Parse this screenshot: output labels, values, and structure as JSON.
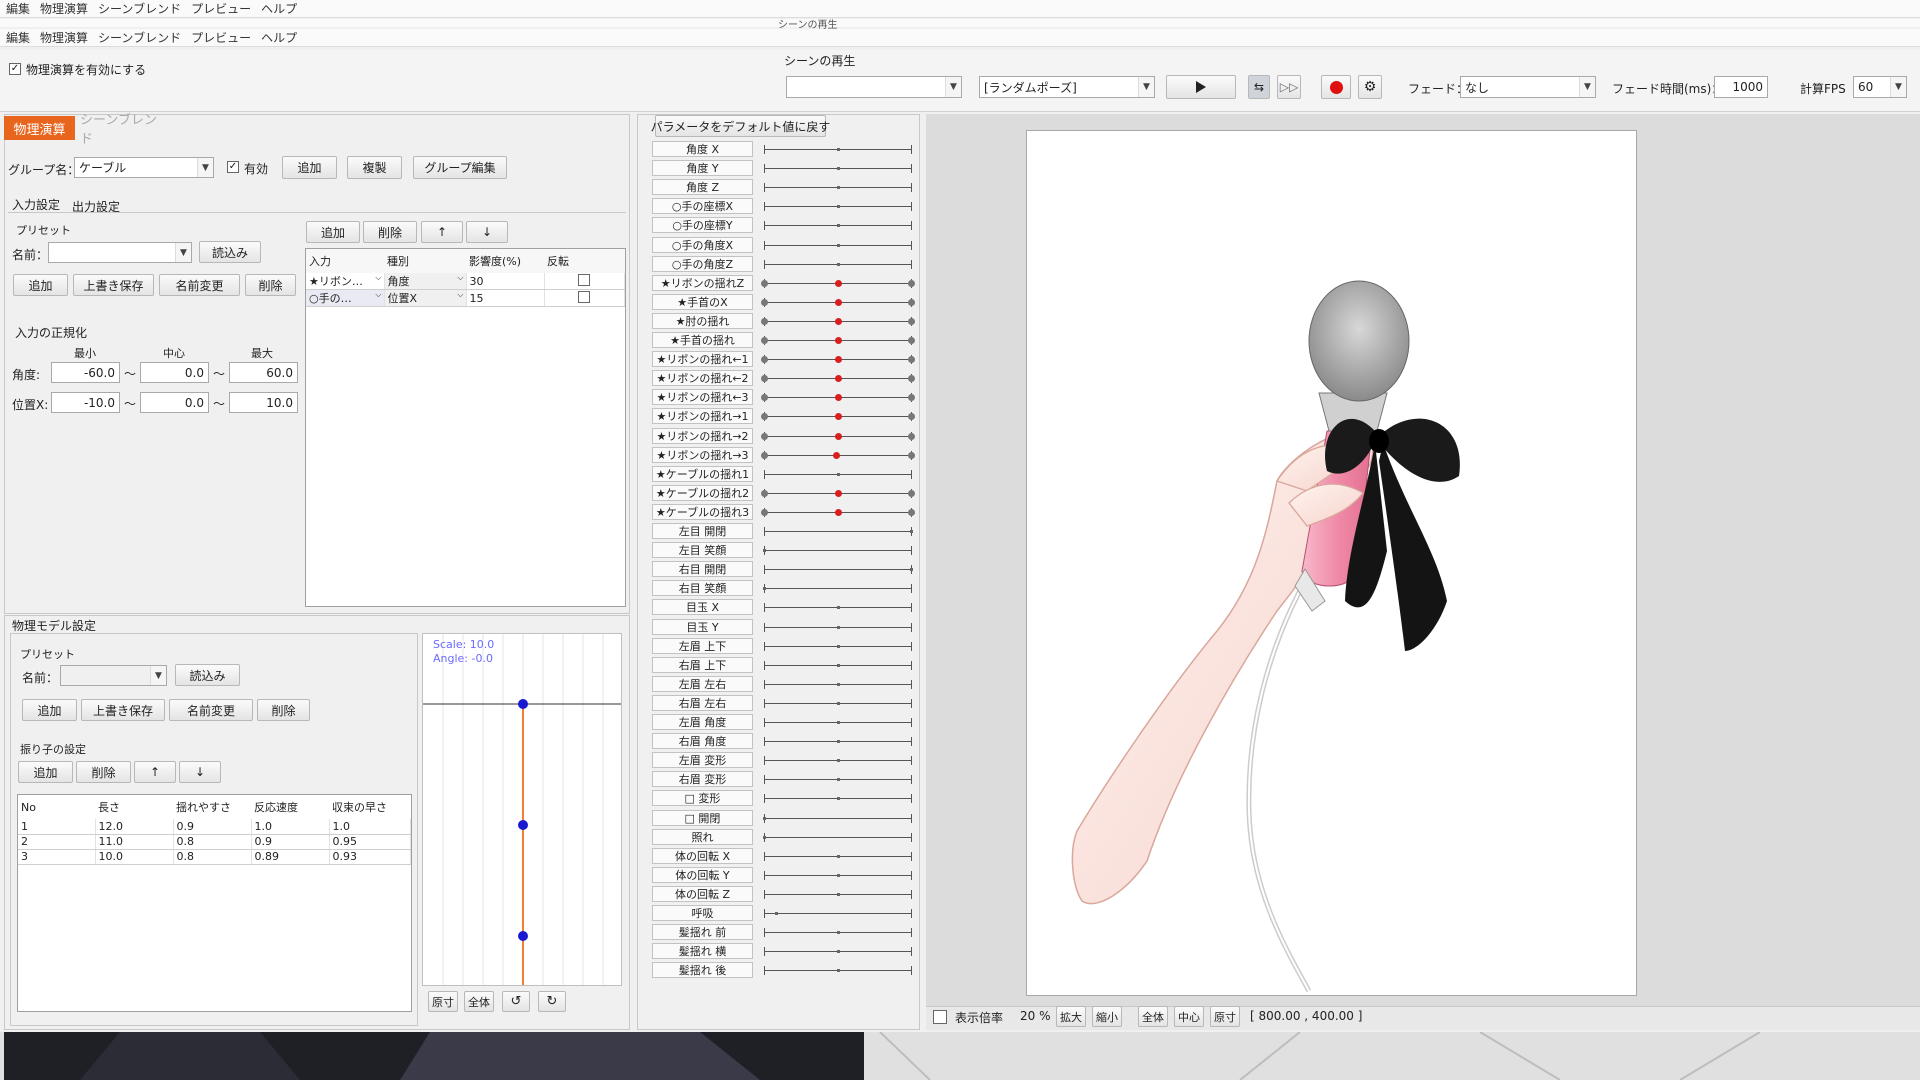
{
  "menu_top": [
    "編集",
    "物理演算",
    "シーンブレンド",
    "プレビュー",
    "ヘルプ"
  ],
  "menu_second": [
    "編集",
    "物理演算",
    "シーンブレンド",
    "プレビュー",
    "ヘルプ"
  ],
  "header_caption": "シーンの再生",
  "scene_play_label": "シーンの再生",
  "physics_enable_label": "物理演算を有効にする",
  "physics_enabled": true,
  "scene_select_value": "",
  "pose_select_value": "[ランダムポーズ]",
  "fade_label": "フェード：",
  "fade_value": "なし",
  "fade_time_label": "フェード時間(ms)：",
  "fade_time_value": "1000",
  "fps_label": "計算FPS",
  "fps_value": "60",
  "tabs": [
    "物理演算",
    "シーンブレンド"
  ],
  "group_label": "グループ名：",
  "group_value": "ケーブル",
  "enabled_label": "有効",
  "enabled_checked": true,
  "group_buttons": [
    "追加",
    "複製",
    "グループ編集"
  ],
  "sub_tabs": [
    "入力設定",
    "出力設定"
  ],
  "preset": {
    "title": "プリセット",
    "name_label": "名前：",
    "load_label": "読込み",
    "buttons": [
      "追加",
      "上書き保存",
      "名前変更",
      "削除"
    ]
  },
  "input_table_buttons": [
    "追加",
    "削除",
    "↑",
    "↓"
  ],
  "input_table": {
    "headers": [
      "入力",
      "種別",
      "影響度(%)",
      "反転"
    ],
    "rows": [
      {
        "input": "★リボン…",
        "type": "角度",
        "weight": "30",
        "invert": false
      },
      {
        "input": "○手の…",
        "type": "位置X",
        "weight": "15",
        "invert": false
      }
    ]
  },
  "normalize": {
    "title": "入力の正規化",
    "col_labels": [
      "最小",
      "中心",
      "最大"
    ],
    "rows": [
      {
        "label": "角度:",
        "min": "-60.0",
        "center": "0.0",
        "max": "60.0"
      },
      {
        "label": "位置X:",
        "min": "-10.0",
        "center": "0.0",
        "max": "10.0"
      }
    ],
    "separator": "～"
  },
  "model": {
    "title": "物理モデル設定",
    "preset_title": "プリセット",
    "name_label": "名前：",
    "load_label": "読込み",
    "buttons": [
      "追加",
      "上書き保存",
      "名前変更",
      "削除"
    ],
    "pendulum_title": "振り子の設定",
    "pendulum_buttons": [
      "追加",
      "削除",
      "↑",
      "↓"
    ],
    "table_headers": [
      "No",
      "長さ",
      "揺れやすさ",
      "反応速度",
      "収束の早さ"
    ],
    "table_rows": [
      [
        "1",
        "12.0",
        "0.9",
        "1.0",
        "1.0"
      ],
      [
        "2",
        "11.0",
        "0.8",
        "0.9",
        "0.95"
      ],
      [
        "3",
        "10.0",
        "0.8",
        "0.89",
        "0.93"
      ]
    ]
  },
  "pendulum_view": {
    "scale_text": "Scale: 10.0",
    "angle_text": "Angle: -0.0",
    "buttons": [
      "原寸",
      "全体",
      "↺",
      "↻"
    ]
  },
  "reset_params_label": "パラメータをデフォルト値に戻す",
  "parameters": [
    {
      "label": "角度 X",
      "dot": 0.5,
      "style": "plain"
    },
    {
      "label": "角度 Y",
      "dot": 0.5,
      "style": "plain"
    },
    {
      "label": "角度 Z",
      "dot": 0.5,
      "style": "plain"
    },
    {
      "label": "○手の座標X",
      "dot": 0.5,
      "style": "plain"
    },
    {
      "label": "○手の座標Y",
      "dot": 0.5,
      "style": "plain"
    },
    {
      "label": "○手の角度X",
      "dot": 0.5,
      "style": "plain"
    },
    {
      "label": "○手の角度Z",
      "dot": 0.5,
      "style": "plain"
    },
    {
      "label": "★リボンの揺れZ",
      "dot": 0.5,
      "style": "red"
    },
    {
      "label": "★手首のX",
      "dot": 0.5,
      "style": "red"
    },
    {
      "label": "★肘の揺れ",
      "dot": 0.5,
      "style": "red"
    },
    {
      "label": "★手首の揺れ",
      "dot": 0.5,
      "style": "red"
    },
    {
      "label": "★リボンの揺れ←1",
      "dot": 0.5,
      "style": "red"
    },
    {
      "label": "★リボンの揺れ←2",
      "dot": 0.5,
      "style": "red"
    },
    {
      "label": "★リボンの揺れ←3",
      "dot": 0.5,
      "style": "red"
    },
    {
      "label": "★リボンの揺れ→1",
      "dot": 0.5,
      "style": "red"
    },
    {
      "label": "★リボンの揺れ→2",
      "dot": 0.5,
      "style": "red"
    },
    {
      "label": "★リボンの揺れ→3",
      "dot": 0.49,
      "style": "red"
    },
    {
      "label": "★ケーブルの揺れ1",
      "dot": 0.5,
      "style": "plain"
    },
    {
      "label": "★ケーブルの揺れ2",
      "dot": 0.5,
      "style": "red"
    },
    {
      "label": "★ケーブルの揺れ3",
      "dot": 0.5,
      "style": "red"
    },
    {
      "label": "左目 開閉",
      "dot": 1.0,
      "style": "end"
    },
    {
      "label": "左目 笑顔",
      "dot": 0.0,
      "style": "end"
    },
    {
      "label": "右目 開閉",
      "dot": 1.0,
      "style": "end"
    },
    {
      "label": "右目 笑顔",
      "dot": 0.0,
      "style": "end"
    },
    {
      "label": "目玉 X",
      "dot": 0.5,
      "style": "plain"
    },
    {
      "label": "目玉 Y",
      "dot": 0.5,
      "style": "plain"
    },
    {
      "label": "左眉 上下",
      "dot": 0.5,
      "style": "plain"
    },
    {
      "label": "右眉 上下",
      "dot": 0.5,
      "style": "plain"
    },
    {
      "label": "左眉 左右",
      "dot": 0.5,
      "style": "plain"
    },
    {
      "label": "右眉 左右",
      "dot": 0.5,
      "style": "plain"
    },
    {
      "label": "左眉 角度",
      "dot": 0.5,
      "style": "plain"
    },
    {
      "label": "右眉 角度",
      "dot": 0.5,
      "style": "plain"
    },
    {
      "label": "左眉 変形",
      "dot": 0.5,
      "style": "plain"
    },
    {
      "label": "右眉 変形",
      "dot": 0.5,
      "style": "plain"
    },
    {
      "label": "□ 変形",
      "dot": 0.5,
      "style": "plain"
    },
    {
      "label": "□ 開閉",
      "dot": 0.0,
      "style": "end"
    },
    {
      "label": "照れ",
      "dot": 0.0,
      "style": "end"
    },
    {
      "label": "体の回転 X",
      "dot": 0.5,
      "style": "plain"
    },
    {
      "label": "体の回転 Y",
      "dot": 0.5,
      "style": "plain"
    },
    {
      "label": "体の回転 Z",
      "dot": 0.5,
      "style": "plain"
    },
    {
      "label": "呼吸",
      "dot": 0.08,
      "style": "plain"
    },
    {
      "label": "髪揺れ 前",
      "dot": 0.5,
      "style": "plain"
    },
    {
      "label": "髪揺れ 横",
      "dot": 0.5,
      "style": "plain"
    },
    {
      "label": "髪揺れ 後",
      "dot": 0.5,
      "style": "plain"
    }
  ],
  "bottom_bar": {
    "zoom_label": "表示倍率",
    "zoom_value": "20 %",
    "buttons": [
      "拡大",
      "縮小",
      "全体",
      "中心",
      "原寸"
    ],
    "coords": "[ 800.00 , 400.00 ]"
  },
  "colors": {
    "tab_active": "#e8651e",
    "param_dot": "#d81e1e",
    "pendulum_line": "#f08030",
    "pendulum_dot": "#1a1ad0",
    "record": "#e01010"
  }
}
